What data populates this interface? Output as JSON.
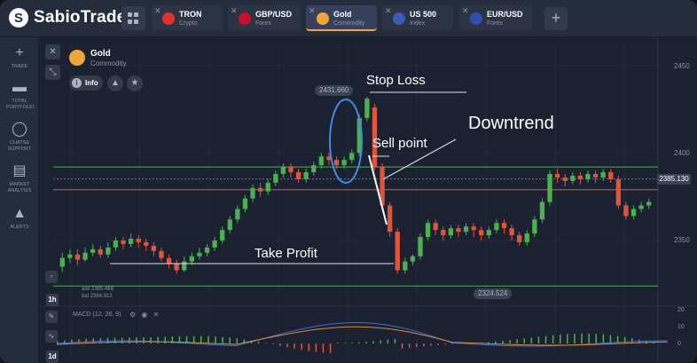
{
  "app": {
    "logo_letter": "S",
    "logo_text": "SabioTrade"
  },
  "tabs": [
    {
      "name": "TRON",
      "type": "Crypto",
      "flag_color": "#e0312f",
      "active": false
    },
    {
      "name": "GBP/USD",
      "type": "Forex",
      "flag_color": "#c8102e",
      "active": false
    },
    {
      "name": "Gold",
      "type": "Commodity",
      "flag_color": "#f2a53a",
      "active": true
    },
    {
      "name": "US 500",
      "type": "Index",
      "flag_color": "#3c5bb5",
      "active": false
    },
    {
      "name": "EUR/USD",
      "type": "Forex",
      "flag_color": "#2f4fb0",
      "active": false
    }
  ],
  "tab_close_glyph": "✕",
  "add_tab_glyph": "+",
  "sidebar": [
    {
      "icon": "plus-icon",
      "glyph": "+",
      "label": "TRADE"
    },
    {
      "icon": "briefcase-icon",
      "glyph": "▬",
      "label": "TOTAL PORTFOLIO"
    },
    {
      "icon": "chat-icon",
      "glyph": "◯",
      "label": "CHATS& SUPPORT"
    },
    {
      "icon": "news-icon",
      "glyph": "▤",
      "label": "MARKET ANALYSIS"
    },
    {
      "icon": "bell-icon",
      "glyph": "▲",
      "label": "ALERTS"
    }
  ],
  "asset": {
    "name": "Gold",
    "type": "Commodity",
    "info_label": "Info"
  },
  "price_axis": {
    "ticks": [
      "2450",
      "2400",
      "2350"
    ],
    "current_price": "2385.130"
  },
  "chart_badges": {
    "high": "2431.660",
    "low": "2324.524"
  },
  "ask_bid": {
    "ask": "ask 2385.468",
    "bid": "bid 2384.912"
  },
  "annotations": {
    "stop_loss": "Stop Loss",
    "downtrend": "Downtrend",
    "sell_point": "Sell point",
    "take_profit": "Take Profit"
  },
  "timeframes": {
    "main": "1h",
    "macd": "1d"
  },
  "macd": {
    "label": "MACD (12, 26, 9)",
    "axis": [
      "20",
      "10",
      "0"
    ],
    "line_color": "#3b6fd6",
    "signal_color": "#e08a3a"
  },
  "colors": {
    "up": "#4caf50",
    "down": "#e0553a",
    "accent": "#f2a53a",
    "level_green": "#4caf50",
    "level_red": "#e0553a",
    "circle": "#3d8de0"
  },
  "candles": [
    [
      2335,
      2340,
      2332,
      2343
    ],
    [
      2340,
      2342,
      2337,
      2345
    ],
    [
      2342,
      2339,
      2336,
      2345
    ],
    [
      2339,
      2343,
      2338,
      2346
    ],
    [
      2343,
      2345,
      2341,
      2348
    ],
    [
      2345,
      2342,
      2340,
      2347
    ],
    [
      2342,
      2346,
      2340,
      2349
    ],
    [
      2346,
      2350,
      2344,
      2352
    ],
    [
      2350,
      2348,
      2345,
      2352
    ],
    [
      2348,
      2351,
      2346,
      2354
    ],
    [
      2351,
      2349,
      2346,
      2353
    ],
    [
      2349,
      2347,
      2344,
      2351
    ],
    [
      2347,
      2344,
      2341,
      2349
    ],
    [
      2344,
      2340,
      2338,
      2346
    ],
    [
      2340,
      2337,
      2334,
      2342
    ],
    [
      2337,
      2333,
      2331,
      2339
    ],
    [
      2333,
      2338,
      2332,
      2341
    ],
    [
      2338,
      2341,
      2336,
      2343
    ],
    [
      2341,
      2343,
      2339,
      2346
    ],
    [
      2343,
      2346,
      2341,
      2348
    ],
    [
      2346,
      2350,
      2344,
      2352
    ],
    [
      2350,
      2356,
      2348,
      2358
    ],
    [
      2356,
      2362,
      2354,
      2364
    ],
    [
      2362,
      2368,
      2360,
      2370
    ],
    [
      2368,
      2374,
      2366,
      2376
    ],
    [
      2374,
      2380,
      2372,
      2382
    ],
    [
      2380,
      2378,
      2375,
      2383
    ],
    [
      2378,
      2383,
      2376,
      2385
    ],
    [
      2383,
      2388,
      2381,
      2390
    ],
    [
      2388,
      2392,
      2386,
      2394
    ],
    [
      2392,
      2389,
      2386,
      2394
    ],
    [
      2389,
      2385,
      2383,
      2391
    ],
    [
      2385,
      2389,
      2383,
      2391
    ],
    [
      2389,
      2393,
      2387,
      2395
    ],
    [
      2393,
      2398,
      2391,
      2400
    ],
    [
      2398,
      2396,
      2393,
      2400
    ],
    [
      2396,
      2393,
      2391,
      2398
    ],
    [
      2393,
      2396,
      2391,
      2398
    ],
    [
      2396,
      2400,
      2394,
      2402
    ],
    [
      2400,
      2420,
      2398,
      2422
    ],
    [
      2420,
      2431,
      2418,
      2432
    ],
    [
      2426,
      2392,
      2390,
      2428
    ],
    [
      2392,
      2370,
      2368,
      2394
    ],
    [
      2370,
      2355,
      2352,
      2372
    ],
    [
      2355,
      2333,
      2331,
      2357
    ],
    [
      2333,
      2338,
      2331,
      2340
    ],
    [
      2338,
      2341,
      2336,
      2342
    ],
    [
      2341,
      2352,
      2339,
      2354
    ],
    [
      2352,
      2360,
      2350,
      2362
    ],
    [
      2360,
      2356,
      2353,
      2362
    ],
    [
      2356,
      2353,
      2350,
      2358
    ],
    [
      2353,
      2357,
      2351,
      2359
    ],
    [
      2357,
      2355,
      2352,
      2359
    ],
    [
      2355,
      2358,
      2353,
      2360
    ],
    [
      2358,
      2356,
      2352,
      2360
    ],
    [
      2356,
      2353,
      2350,
      2358
    ],
    [
      2353,
      2356,
      2351,
      2358
    ],
    [
      2356,
      2360,
      2354,
      2362
    ],
    [
      2360,
      2357,
      2354,
      2362
    ],
    [
      2357,
      2353,
      2350,
      2359
    ],
    [
      2353,
      2349,
      2347,
      2355
    ],
    [
      2349,
      2354,
      2347,
      2356
    ],
    [
      2354,
      2362,
      2352,
      2364
    ],
    [
      2362,
      2372,
      2360,
      2374
    ],
    [
      2372,
      2388,
      2370,
      2390
    ],
    [
      2388,
      2386,
      2383,
      2391
    ],
    [
      2386,
      2384,
      2381,
      2388
    ],
    [
      2384,
      2387,
      2382,
      2389
    ],
    [
      2387,
      2385,
      2382,
      2389
    ],
    [
      2385,
      2388,
      2383,
      2390
    ],
    [
      2388,
      2386,
      2383,
      2390
    ],
    [
      2386,
      2389,
      2384,
      2391
    ],
    [
      2389,
      2385,
      2383,
      2391
    ],
    [
      2385,
      2370,
      2368,
      2387
    ],
    [
      2370,
      2364,
      2362,
      2372
    ],
    [
      2364,
      2368,
      2362,
      2370
    ],
    [
      2368,
      2370,
      2366,
      2372
    ],
    [
      2370,
      2372,
      2368,
      2374
    ]
  ]
}
